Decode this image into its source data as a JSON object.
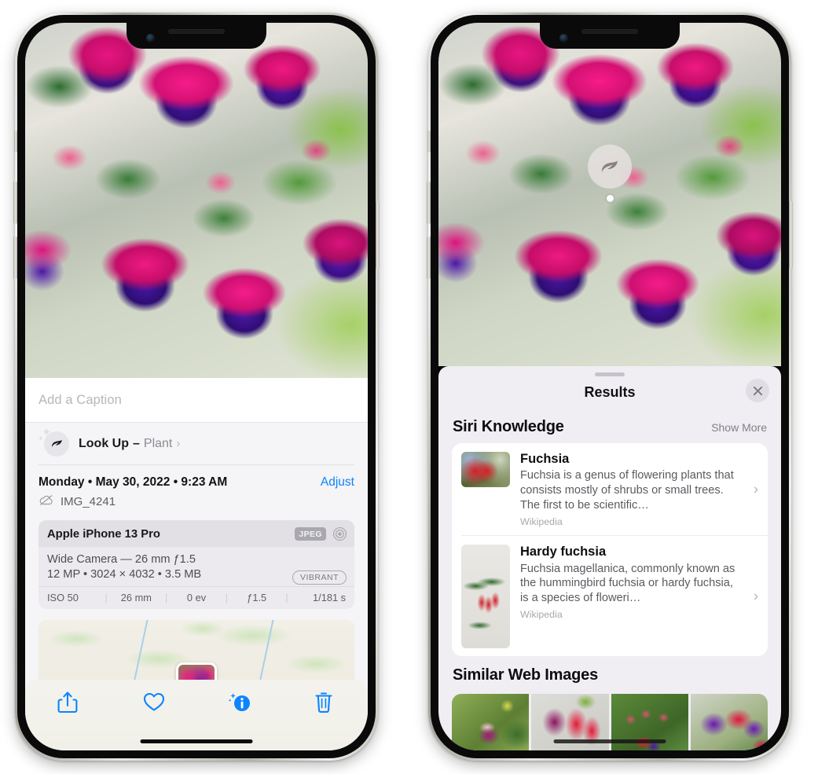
{
  "left_phone": {
    "caption_field": {
      "placeholder": "Add a Caption",
      "value": ""
    },
    "look_up": {
      "icon": "leaf-icon",
      "sparkle_icon": "sparkle-icon",
      "label": "Look Up",
      "dash": "–",
      "subject": "Plant",
      "chevron": "›"
    },
    "date_row": {
      "date_text": "Monday • May 30, 2022 • 9:23 AM",
      "adjust_label": "Adjust"
    },
    "file_row": {
      "icon": "cloud-slash-icon",
      "filename": "IMG_4241"
    },
    "camera_card": {
      "device": "Apple iPhone 13 Pro",
      "format_badge": "JPEG",
      "lens_icon": "aperture-icon",
      "lens_line": "Wide Camera — 26 mm ƒ1.5",
      "size_line": "12 MP • 3024 × 4032 • 3.5 MB",
      "style_badge": "VIBRANT",
      "exif": [
        "ISO 50",
        "26 mm",
        "0 ev",
        "ƒ1.5",
        "1/181 s"
      ]
    },
    "map": {
      "pin_label": "photo-thumbnail-pin"
    },
    "toolbar": [
      {
        "name": "share-icon",
        "label": "Share"
      },
      {
        "name": "heart-icon",
        "label": "Favorite"
      },
      {
        "name": "info-icon",
        "label": "Info"
      },
      {
        "name": "trash-icon",
        "label": "Delete"
      }
    ]
  },
  "right_phone": {
    "visual_lookup_badge": {
      "icon": "leaf-icon"
    },
    "sheet": {
      "grabber": "drag-handle",
      "title": "Results",
      "close_icon": "close-icon"
    },
    "siri_knowledge": {
      "heading": "Siri Knowledge",
      "action": "Show More",
      "items": [
        {
          "title": "Fuchsia",
          "description": "Fuchsia is a genus of flowering plants that consists mostly of shrubs or small trees. The first to be scientific…",
          "source": "Wikipedia",
          "chevron": "›"
        },
        {
          "title": "Hardy fuchsia",
          "description": "Fuchsia magellanica, commonly known as the hummingbird fuchsia or hardy fuchsia, is a species of floweri…",
          "source": "Wikipedia",
          "chevron": "›"
        }
      ]
    },
    "similar_web_images": {
      "heading": "Similar Web Images",
      "thumbnails": [
        "fuchsia-web-image-1",
        "fuchsia-web-image-2",
        "fuchsia-web-image-3",
        "fuchsia-web-image-4"
      ]
    }
  },
  "colors": {
    "accent_blue": "#0b84ff",
    "sheet_bg": "#f0eef3",
    "card_bg": "#ffffff",
    "secondary_text": "#8c8b92"
  }
}
